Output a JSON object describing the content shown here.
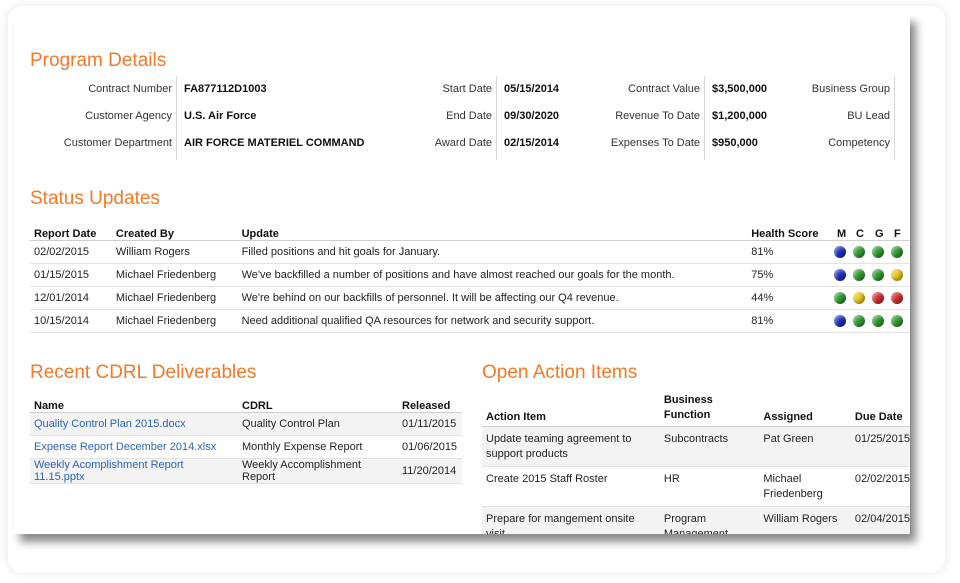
{
  "program_details": {
    "title": "Program Details",
    "col1": [
      {
        "label": "Contract Number",
        "value": "FA877112D1003"
      },
      {
        "label": "Customer Agency",
        "value": "U.S. Air Force"
      },
      {
        "label": "Customer Department",
        "value": "AIR FORCE MATERIEL COMMAND"
      }
    ],
    "col2": [
      {
        "label": "Start Date",
        "value": "05/15/2014"
      },
      {
        "label": "End Date",
        "value": "09/30/2020"
      },
      {
        "label": "Award Date",
        "value": "02/15/2014"
      }
    ],
    "col3": [
      {
        "label": "Contract Value",
        "value": "$3,500,000"
      },
      {
        "label": "Revenue To Date",
        "value": "$1,200,000"
      },
      {
        "label": "Expenses To Date",
        "value": "$950,000"
      }
    ],
    "col4": [
      {
        "label": "Business Group"
      },
      {
        "label": "BU Lead"
      },
      {
        "label": "Competency"
      }
    ]
  },
  "status_updates": {
    "title": "Status Updates",
    "headers": {
      "date": "Report Date",
      "by": "Created By",
      "update": "Update",
      "health": "Health Score",
      "m": "M",
      "c": "C",
      "g": "G",
      "f": "F"
    },
    "rows": [
      {
        "date": "02/02/2015",
        "by": "William Rogers",
        "update": "Filled positions and hit goals for January.",
        "health": "81%",
        "indicators": [
          "blue",
          "green",
          "green",
          "green"
        ]
      },
      {
        "date": "01/15/2015",
        "by": "Michael Friedenberg",
        "update": "We've backfilled a number of positions and have almost reached our goals for the month.",
        "health": "75%",
        "indicators": [
          "blue",
          "green",
          "green",
          "yellow"
        ]
      },
      {
        "date": "12/01/2014",
        "by": "Michael Friedenberg",
        "update": "We're behind on our backfills of personnel.  It will be affecting our Q4 revenue.",
        "health": "44%",
        "indicators": [
          "green",
          "yellow",
          "red",
          "red"
        ]
      },
      {
        "date": "10/15/2014",
        "by": "Michael Friedenberg",
        "update": "Need additional qualified QA resources for network and security support.",
        "health": "81%",
        "indicators": [
          "blue",
          "green",
          "green",
          "green"
        ]
      }
    ]
  },
  "cdrl": {
    "title": "Recent CDRL Deliverables",
    "headers": {
      "name": "Name",
      "cdrl": "CDRL",
      "released": "Released"
    },
    "rows": [
      {
        "name": "Quality Control Plan 2015.docx",
        "cdrl": "Quality Control Plan",
        "released": "01/11/2015"
      },
      {
        "name": "Expense Report December 2014.xlsx",
        "cdrl": "Monthly Expense Report",
        "released": "01/06/2015"
      },
      {
        "name": "Weekly Acomplishment Report 11.15.pptx",
        "cdrl": "Weekly Accomplishment Report",
        "released": "11/20/2014"
      }
    ]
  },
  "actions": {
    "title": "Open Action Items",
    "headers": {
      "item": "Action Item",
      "func_line1": "Business",
      "func_line2": "Function",
      "assigned": "Assigned",
      "due": "Due Date"
    },
    "rows": [
      {
        "item": "Update teaming agreement to support products",
        "func": "Subcontracts",
        "assigned": "Pat Green",
        "due": "01/25/2015"
      },
      {
        "item": "Create 2015 Staff Roster",
        "func": "HR",
        "assigned": "Michael Friedenberg",
        "due": "02/02/2015"
      },
      {
        "item": "Prepare for mangement onsite visit",
        "func": "Program Management",
        "assigned": "William Rogers",
        "due": "02/04/2015"
      }
    ]
  },
  "colors": {
    "accent": "#f07a28",
    "link": "#2a63b7",
    "indicator_blue": "#1b2fb8",
    "indicator_green": "#2e9a2e",
    "indicator_yellow": "#e8c81a",
    "indicator_red": "#d42b2b"
  }
}
